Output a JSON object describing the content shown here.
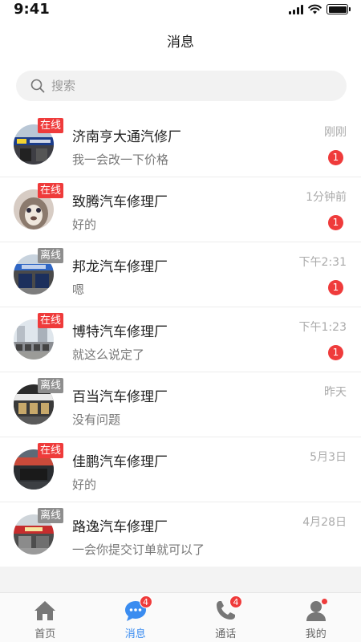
{
  "status_bar": {
    "time": "9:41",
    "icons": [
      "signal-icon",
      "wifi-icon",
      "battery-icon"
    ]
  },
  "header": {
    "title": "消息"
  },
  "search": {
    "placeholder": "搜索"
  },
  "colors": {
    "online": "#ef3b3b",
    "offline": "#8e8e8e",
    "unread": "#ef3b3b",
    "accent": "#3a8cf0"
  },
  "conversations": [
    {
      "status": "在线",
      "name": "济南亨大通汽修厂",
      "message": "我一会改一下价格",
      "time": "刚刚",
      "unread": "1"
    },
    {
      "status": "在线",
      "name": "致腾汽车修理厂",
      "message": "好的",
      "time": "1分钟前",
      "unread": "1"
    },
    {
      "status": "离线",
      "name": "邦龙汽车修理厂",
      "message": "嗯",
      "time": "下午2:31",
      "unread": "1"
    },
    {
      "status": "在线",
      "name": "博特汽车修理厂",
      "message": "就这么说定了",
      "time": "下午1:23",
      "unread": "1"
    },
    {
      "status": "离线",
      "name": "百当汽车修理厂",
      "message": "没有问题",
      "time": "昨天",
      "unread": ""
    },
    {
      "status": "在线",
      "name": "佳鹏汽车修理厂",
      "message": "好的",
      "time": "5月3日",
      "unread": ""
    },
    {
      "status": "离线",
      "name": "路逸汽车修理厂",
      "message": "一会你提交订单就可以了",
      "time": "4月28日",
      "unread": ""
    }
  ],
  "tabbar": {
    "tabs": [
      {
        "label": "首页",
        "icon": "home-icon",
        "badge": ""
      },
      {
        "label": "消息",
        "icon": "chat-icon",
        "badge": "4"
      },
      {
        "label": "通话",
        "icon": "phone-icon",
        "badge": "4"
      },
      {
        "label": "我的",
        "icon": "profile-icon",
        "badge": ""
      }
    ]
  }
}
